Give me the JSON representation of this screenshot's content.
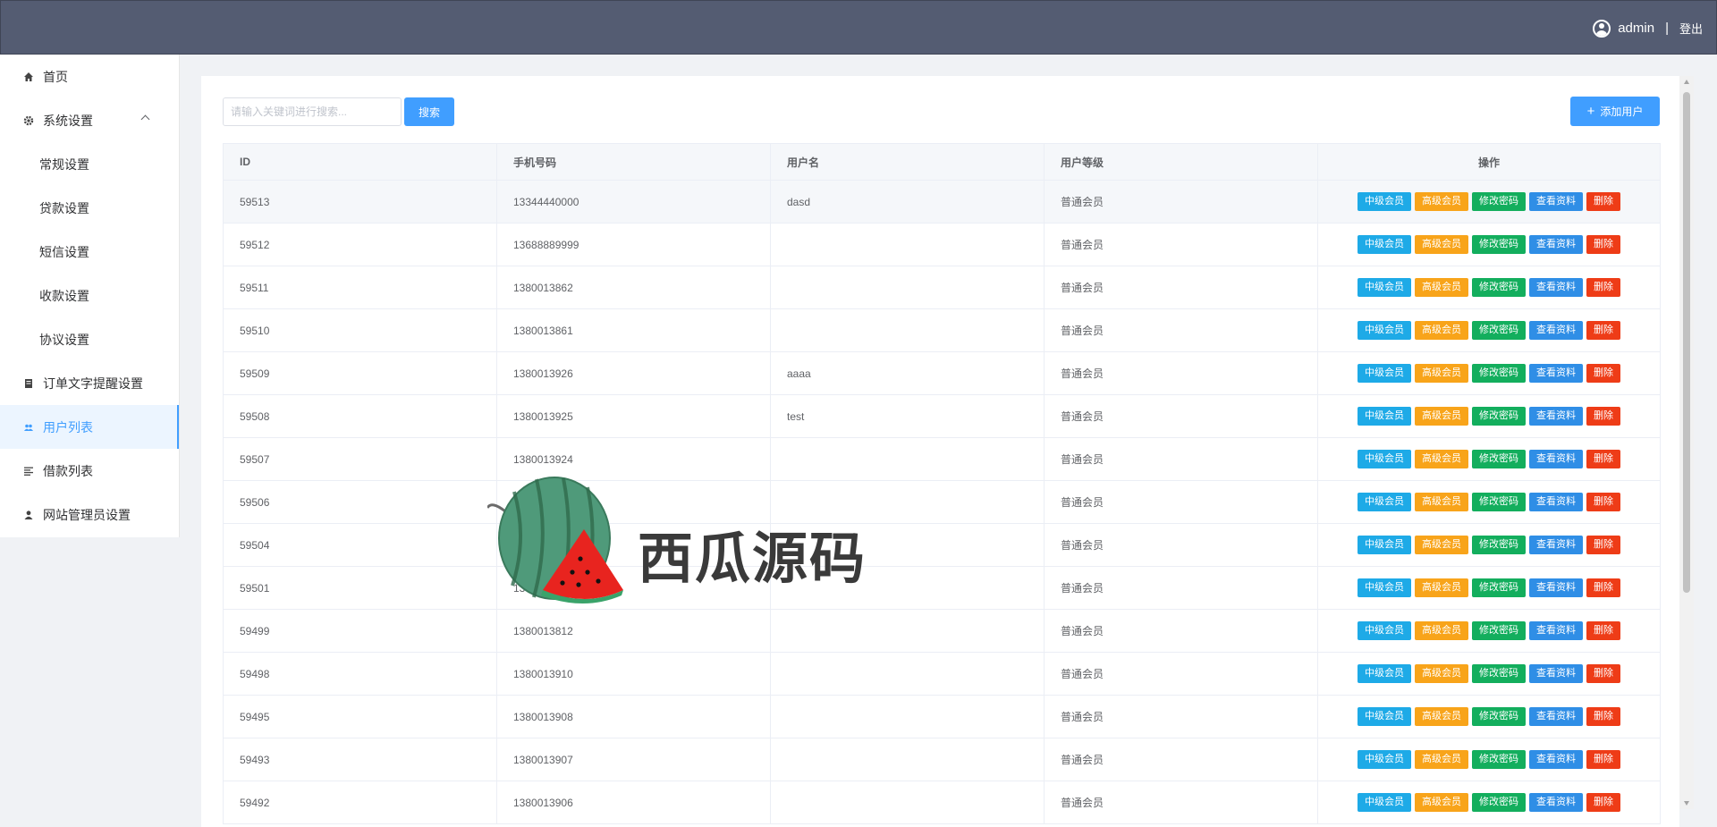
{
  "header": {
    "username": "admin",
    "separator": "|",
    "logout_label": "登出"
  },
  "sidebar": {
    "home": "首页",
    "system_settings": "系统设置",
    "sub_items": [
      "常规设置",
      "贷款设置",
      "短信设置",
      "收款设置",
      "协议设置"
    ],
    "order_text": "订单文字提醒设置",
    "user_list": "用户列表",
    "loan_list": "借款列表",
    "admin_settings": "网站管理员设置"
  },
  "toolbar": {
    "search_placeholder": "请输入关键词进行搜索...",
    "search_label": "搜索",
    "add_user_label": "添加用户",
    "add_icon": "+"
  },
  "table": {
    "columns": [
      "ID",
      "手机号码",
      "用户名",
      "用户等级",
      "操作"
    ],
    "actions": [
      "中级会员",
      "高级会员",
      "修改密码",
      "查看资料",
      "删除"
    ],
    "rows": [
      {
        "id": "59513",
        "phone": "13344440000",
        "name": "dasd",
        "level": "普通会员"
      },
      {
        "id": "59512",
        "phone": "13688889999",
        "name": "",
        "level": "普通会员"
      },
      {
        "id": "59511",
        "phone": "1380013862",
        "name": "",
        "level": "普通会员"
      },
      {
        "id": "59510",
        "phone": "1380013861",
        "name": "",
        "level": "普通会员"
      },
      {
        "id": "59509",
        "phone": "1380013926",
        "name": "aaaa",
        "level": "普通会员"
      },
      {
        "id": "59508",
        "phone": "1380013925",
        "name": "test",
        "level": "普通会员"
      },
      {
        "id": "59507",
        "phone": "1380013924",
        "name": "",
        "level": "普通会员"
      },
      {
        "id": "59506",
        "phone": "",
        "name": "",
        "level": "普通会员"
      },
      {
        "id": "59504",
        "phone": "",
        "name": "",
        "level": "普通会员"
      },
      {
        "id": "59501",
        "phone": "1380",
        "name": "",
        "level": "普通会员"
      },
      {
        "id": "59499",
        "phone": "1380013812",
        "name": "",
        "level": "普通会员"
      },
      {
        "id": "59498",
        "phone": "1380013910",
        "name": "",
        "level": "普通会员"
      },
      {
        "id": "59495",
        "phone": "1380013908",
        "name": "",
        "level": "普通会员"
      },
      {
        "id": "59493",
        "phone": "1380013907",
        "name": "",
        "level": "普通会员"
      },
      {
        "id": "59492",
        "phone": "1380013906",
        "name": "",
        "level": "普通会员"
      }
    ]
  },
  "watermark": {
    "text": "西瓜源码"
  },
  "colors": {
    "header": "#545c72",
    "primary": "#409eff",
    "mid": "#1eaae7",
    "high": "#f8a41a",
    "pwd": "#13ae5d",
    "view": "#2f8ee6",
    "del": "#ee3c17"
  }
}
